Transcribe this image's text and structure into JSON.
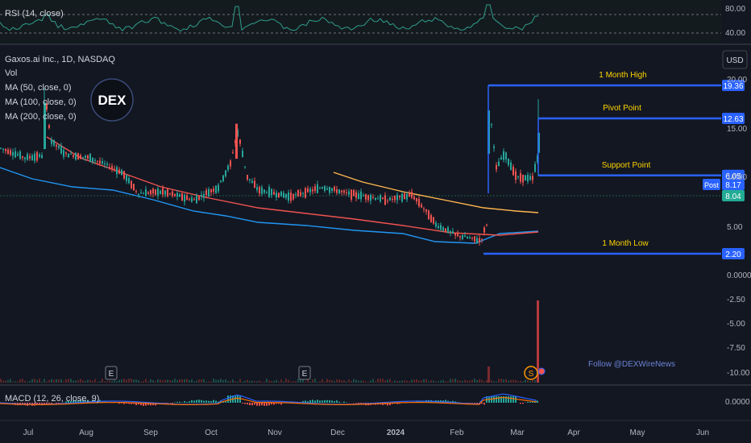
{
  "rsi": {
    "label": "RSI (14, close)",
    "ticks": [
      "80.00",
      "40.00"
    ]
  },
  "main": {
    "info": [
      "Gaxos.ai Inc., 1D, NASDAQ",
      "Vol",
      "MA (50, close, 0)",
      "MA (100, close, 0)",
      "MA (200, close, 0)"
    ],
    "currency": "USD",
    "logo_text": "DEX",
    "follow": "Follow @DEXWireNews",
    "earnings_marker": "E",
    "split_marker": "S"
  },
  "macd": {
    "label": "MACD (12, 26, close, 9)",
    "tick": "0.0000"
  },
  "chart_data": {
    "type": "candlestick",
    "title": "Gaxos.ai Inc., 1D, NASDAQ",
    "x_tick_labels": [
      "Jul",
      "Aug",
      "Sep",
      "Oct",
      "Nov",
      "Dec",
      "2024",
      "Feb",
      "Mar",
      "Apr",
      "May",
      "Jun"
    ],
    "y_tick_labels": [
      "20.00",
      "19.36",
      "15.00",
      "12.63",
      "10.00",
      "8.17",
      "8.04",
      "6.05",
      "5.00",
      "2.20",
      "0.0000",
      "-2.50",
      "-5.00",
      "-7.50",
      "-10.00"
    ],
    "y_axis": "price (USD), log scale",
    "price_badges": [
      {
        "label": "19.36",
        "value": 19.36,
        "color": "#2962ff"
      },
      {
        "label": "12.63",
        "value": 12.63,
        "color": "#2962ff"
      },
      {
        "label": "8.17",
        "value": 8.17,
        "color": "#2962ff",
        "tag": "Post"
      },
      {
        "label": "8.04",
        "value": 8.04,
        "color": "#22ab94"
      },
      {
        "label": "6.05",
        "value": 6.05,
        "color": "#2962ff"
      },
      {
        "label": "2.20",
        "value": 2.2,
        "color": "#2962ff"
      }
    ],
    "levels": [
      {
        "name": "1 Month High",
        "value": 19.36,
        "color": "#2962ff"
      },
      {
        "name": "Pivot Point",
        "value": 12.63,
        "color": "#2962ff"
      },
      {
        "name": "Support Point",
        "value": 6.05,
        "color": "#2962ff"
      },
      {
        "name": "1 Month Low",
        "value": 2.2,
        "color": "#2962ff"
      }
    ],
    "moving_averages": [
      {
        "name": "MA (50, close, 0)",
        "color": "#2196f3"
      },
      {
        "name": "MA (100, close, 0)",
        "color": "#ef5350"
      },
      {
        "name": "MA (200, close, 0)",
        "color": "#ffb74d"
      }
    ],
    "colors": {
      "up": "#26a69a",
      "down": "#ef5350",
      "background": "#131722",
      "level_label": "#ffd600",
      "rsi": "#2e9d8a"
    }
  }
}
